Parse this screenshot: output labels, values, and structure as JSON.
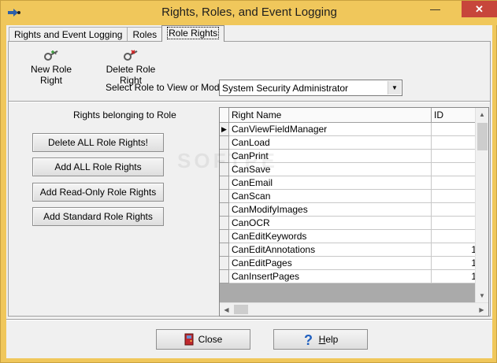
{
  "window": {
    "title": "Rights, Roles, and Event Logging",
    "close_glyph": "✕",
    "min_glyph": "—",
    "max_glyph": "☐"
  },
  "tabs": [
    {
      "label": "Rights and Event Logging"
    },
    {
      "label": "Roles"
    },
    {
      "label": "Role Rights",
      "active": true
    }
  ],
  "toolbar": {
    "new_role_right": "New Role Right",
    "delete_role_right": "Delete Role Right"
  },
  "role_select": {
    "label": "Select Role to View or Modify",
    "value": "System Security Administrator"
  },
  "rights_panel": {
    "label": "Rights belonging to Role",
    "buttons": {
      "delete_all": "Delete ALL Role Rights!",
      "add_all": "Add ALL Role Rights",
      "add_readonly": "Add Read-Only Role Rights",
      "add_standard": "Add Standard Role Rights"
    }
  },
  "grid": {
    "columns": [
      "Right Name",
      "ID"
    ],
    "rows": [
      {
        "name": "CanViewFieldManager",
        "id": ""
      },
      {
        "name": "CanLoad",
        "id": ""
      },
      {
        "name": "CanPrint",
        "id": ""
      },
      {
        "name": "CanSave",
        "id": ""
      },
      {
        "name": "CanEmail",
        "id": ""
      },
      {
        "name": "CanScan",
        "id": ""
      },
      {
        "name": "CanModifyImages",
        "id": ""
      },
      {
        "name": "CanOCR",
        "id": ""
      },
      {
        "name": "CanEditKeywords",
        "id": ""
      },
      {
        "name": "CanEditAnnotations",
        "id": "1"
      },
      {
        "name": "CanEditPages",
        "id": "1"
      },
      {
        "name": "CanInsertPages",
        "id": "1"
      }
    ]
  },
  "watermark": "SOFTPE",
  "footer": {
    "close_label": "Close",
    "help_label": "Help"
  },
  "colors": {
    "title_bar": "#f0c75b",
    "close_button": "#c7463b"
  }
}
